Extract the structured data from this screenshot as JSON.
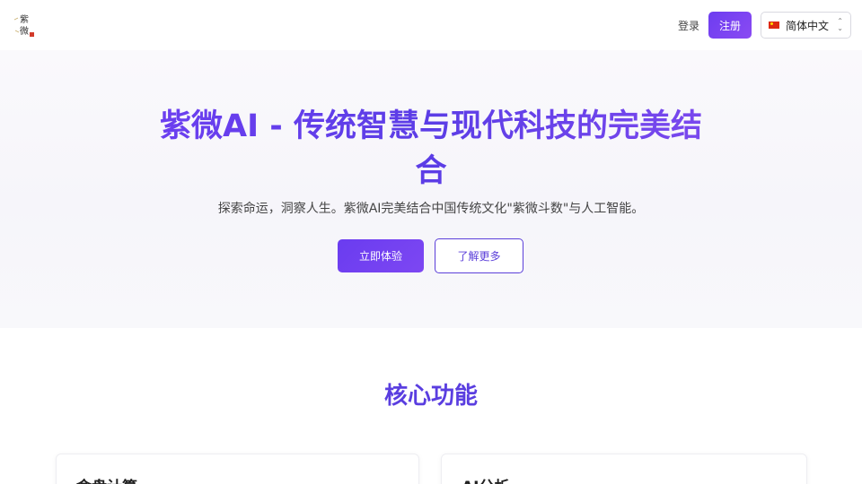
{
  "header": {
    "logo_text": "紫微",
    "login_label": "登录",
    "signup_label": "注册",
    "language": {
      "selected": "简体中文",
      "flag_icon": "cn-flag-icon"
    }
  },
  "hero": {
    "title": "紫微AI - 传统智慧与现代科技的完美结合",
    "subtitle": "探索命运，洞察人生。紫微AI完美结合中国传统文化\"紫微斗数\"与人工智能。",
    "primary_button": "立即体验",
    "secondary_button": "了解更多"
  },
  "features": {
    "title": "核心功能",
    "cards": [
      {
        "title": "命盘计算"
      },
      {
        "title": "AI分析"
      }
    ]
  },
  "colors": {
    "accent": "#6a3cf0",
    "accent_dark": "#5b3fd9"
  }
}
